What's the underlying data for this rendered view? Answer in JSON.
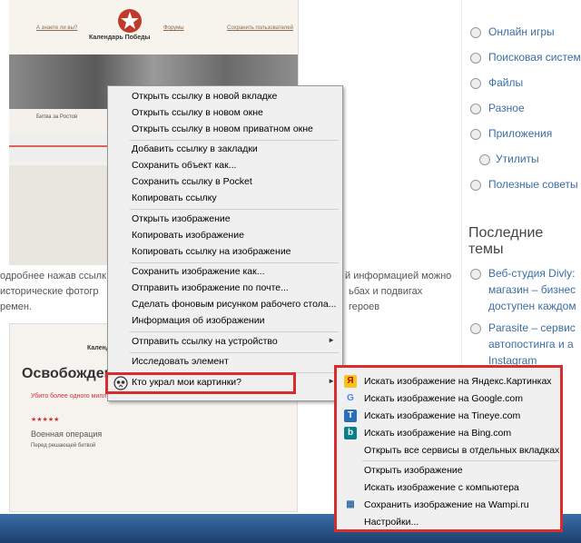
{
  "site": {
    "nav": [
      "А знаете ли вы?",
      "Форумы",
      "Сохранить пользователей"
    ],
    "title": "Календарь Победы",
    "caption_left": "Битва за Ростов"
  },
  "article": {
    "line1": "одробнее нажав ссылк",
    "line1_right": "й информацией можно",
    "line2": "исторические фотогр",
    "line2_right": "ьбах и подвигах героев",
    "line3": "ремен."
  },
  "card2": {
    "title": "Освобожден",
    "header_right": "Календ",
    "subtitle": "Убито более одного миллиона человек",
    "op": "Военная операция",
    "battle": "Перед решающей битвой"
  },
  "sidebar": {
    "items": [
      "Онлайн игры",
      "Поисковая систем",
      "Файлы",
      "Разное",
      "Приложения",
      "Утилиты",
      "Полезные советы"
    ],
    "heading": "Последние темы",
    "recent": [
      "Веб-студия Divly:",
      "магазин – бизнес",
      "доступен каждом",
      "Parasite – сервис",
      "автопостинга и а",
      "Instagram"
    ]
  },
  "context_menu": {
    "items": [
      "Открыть ссылку в новой вкладке",
      "Открыть ссылку в новом окне",
      "Открыть ссылку в новом приватном окне",
      "Добавить ссылку в закладки",
      "Сохранить объект как...",
      "Сохранить ссылку в Pocket",
      "Копировать ссылку",
      "Открыть изображение",
      "Копировать изображение",
      "Копировать ссылку на изображение",
      "Сохранить изображение как...",
      "Отправить изображение по почте...",
      "Сделать фоновым рисунком рабочего стола...",
      "Информация об изображении",
      "Отправить ссылку на устройство",
      "Исследовать элемент",
      "Кто украл мои картинки?"
    ]
  },
  "submenu": {
    "items": [
      "Искать изображение на Яндекс.Картинках",
      "Искать изображение на Google.com",
      "Искать изображение на Tineye.com",
      "Искать изображение на Bing.com",
      "Открыть все сервисы в отдельных вкладках",
      "Открыть изображение",
      "Искать изображение с компьютера",
      "Сохранить изображение на Wampi.ru",
      "Настройки..."
    ]
  },
  "colors": {
    "highlight": "#d82d2d",
    "link": "#3a6ea5"
  }
}
